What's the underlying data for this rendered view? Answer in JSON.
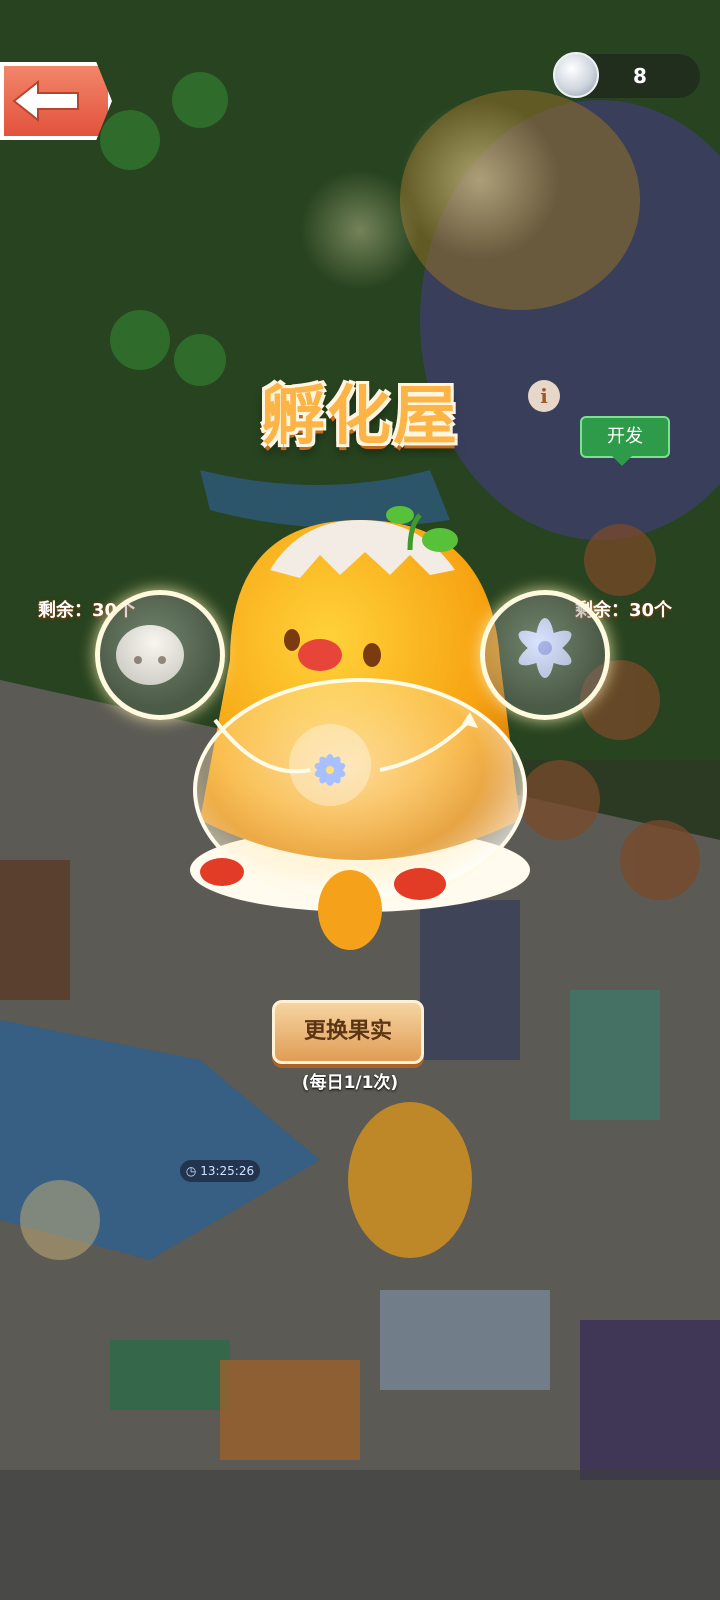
{
  "header": {
    "coin_count": "8"
  },
  "hatchery": {
    "title": "孵化屋",
    "info_glyph": "i",
    "develop_label": "开发",
    "left_remaining": "剩余：30个",
    "right_remaining": "剩余：30个",
    "swap_button_label": "更换果实",
    "daily_limit_text": "(每日1/1次)"
  },
  "scene": {
    "timer_text": "13:25:26"
  },
  "colors": {
    "accent_orange": "#e09d55",
    "back_button": "#e2523c",
    "develop_green": "#2d9b4a",
    "title_gold": "#fbb445"
  },
  "icons": [
    "back-arrow-icon",
    "coin-icon",
    "info-icon",
    "seedling-icon",
    "flower-icon",
    "clock-icon"
  ]
}
